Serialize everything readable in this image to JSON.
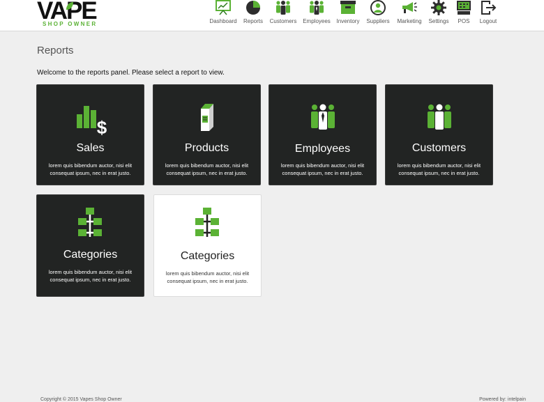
{
  "brand": {
    "name": "VAPE",
    "tagline": "SHOP OWNER"
  },
  "nav": [
    {
      "label": "Dashboard",
      "icon": "dashboard-icon"
    },
    {
      "label": "Reports",
      "icon": "pie-chart-icon"
    },
    {
      "label": "Customers",
      "icon": "customers-icon"
    },
    {
      "label": "Employees",
      "icon": "employees-icon"
    },
    {
      "label": "Inventory",
      "icon": "inventory-box-icon"
    },
    {
      "label": "Suppliers",
      "icon": "suppliers-icon"
    },
    {
      "label": "Marketing",
      "icon": "megaphone-icon"
    },
    {
      "label": "Settings",
      "icon": "gear-icon"
    },
    {
      "label": "POS",
      "icon": "pos-register-icon"
    },
    {
      "label": "Logout",
      "icon": "logout-icon"
    }
  ],
  "page": {
    "title": "Reports",
    "welcome": "Welcome to the reports panel. Please select a report to view."
  },
  "cards": [
    {
      "title": "Sales",
      "desc": "lorem quis bibendum auctor, nisi elit consequat ipsum, nec in erat justo.",
      "icon": "sales-chart-icon",
      "theme": "dark"
    },
    {
      "title": "Products",
      "desc": "lorem quis bibendum auctor, nisi elit consequat ipsum, nec in erat justo.",
      "icon": "product-carton-icon",
      "theme": "dark"
    },
    {
      "title": "Employees",
      "desc": "lorem quis bibendum auctor, nisi elit consequat ipsum, nec in erat justo.",
      "icon": "employees-icon",
      "theme": "dark"
    },
    {
      "title": "Customers",
      "desc": "lorem quis bibendum auctor, nisi elit consequat ipsum, nec in erat justo.",
      "icon": "customers-icon",
      "theme": "dark"
    },
    {
      "title": "Categories",
      "desc": "lorem quis bibendum auctor, nisi elit consequat ipsum, nec in erat justo.",
      "icon": "category-tree-icon",
      "theme": "dark"
    },
    {
      "title": "Categories",
      "desc": "lorem quis bibendum auctor, nisi elit consequat ipsum, nec in erat justo.",
      "icon": "category-tree-icon",
      "theme": "light"
    }
  ],
  "footer": {
    "copyright": "Copyright © 2015 Vapes Shop Owner",
    "powered": "Powered by: intelpain"
  },
  "colors": {
    "accent": "#5bb235",
    "card_dark": "#222423",
    "background": "#efefef"
  }
}
